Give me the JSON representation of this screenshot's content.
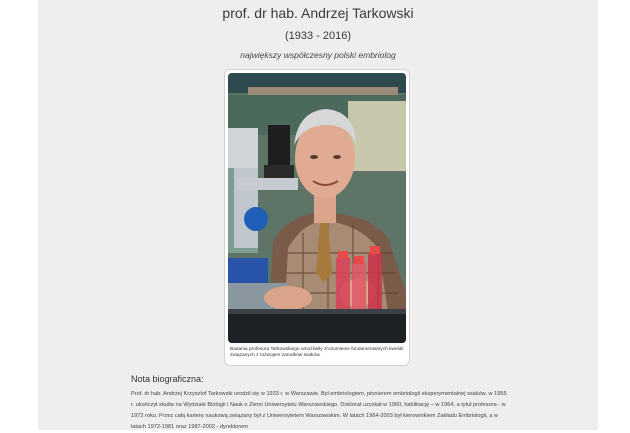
{
  "header": {
    "title": "prof. dr hab. Andrzej Tarkowski",
    "years": "(1933 - 2016)",
    "subtitle": "największy współczesny polski embriolog"
  },
  "figure": {
    "caption": "Badania profesora Tarkowskiego umożliwiły zrozumienie fundamentalnych kwestii związanych z rozwojem zarodków ssaków."
  },
  "bio": {
    "heading": "Nota biograficzna:",
    "text": "Prof. dr hab. Andrzej Krzysztof Tarkowski urodził się w 1933 r. w Warszawie. Był embriologiem, pionierem embriologii eksperymentalnej ssaków. w 1955 r. ukończył studia na Wydziale Biologii i Nauk o Ziemi Uniwersytetu Warszawskiego. Doktorat uzyskał w 1960, habilitację – w 1964, a tytuł profesora - w 1972 roku. Przez całą karierę naukową związany był z Uniwersytetem Warszawskim. W latach 1964-2003 był kierownikiem Zakładu Embriologii, a w latach 1972-1981 oraz 1987-2002 - dyrektorem"
  }
}
